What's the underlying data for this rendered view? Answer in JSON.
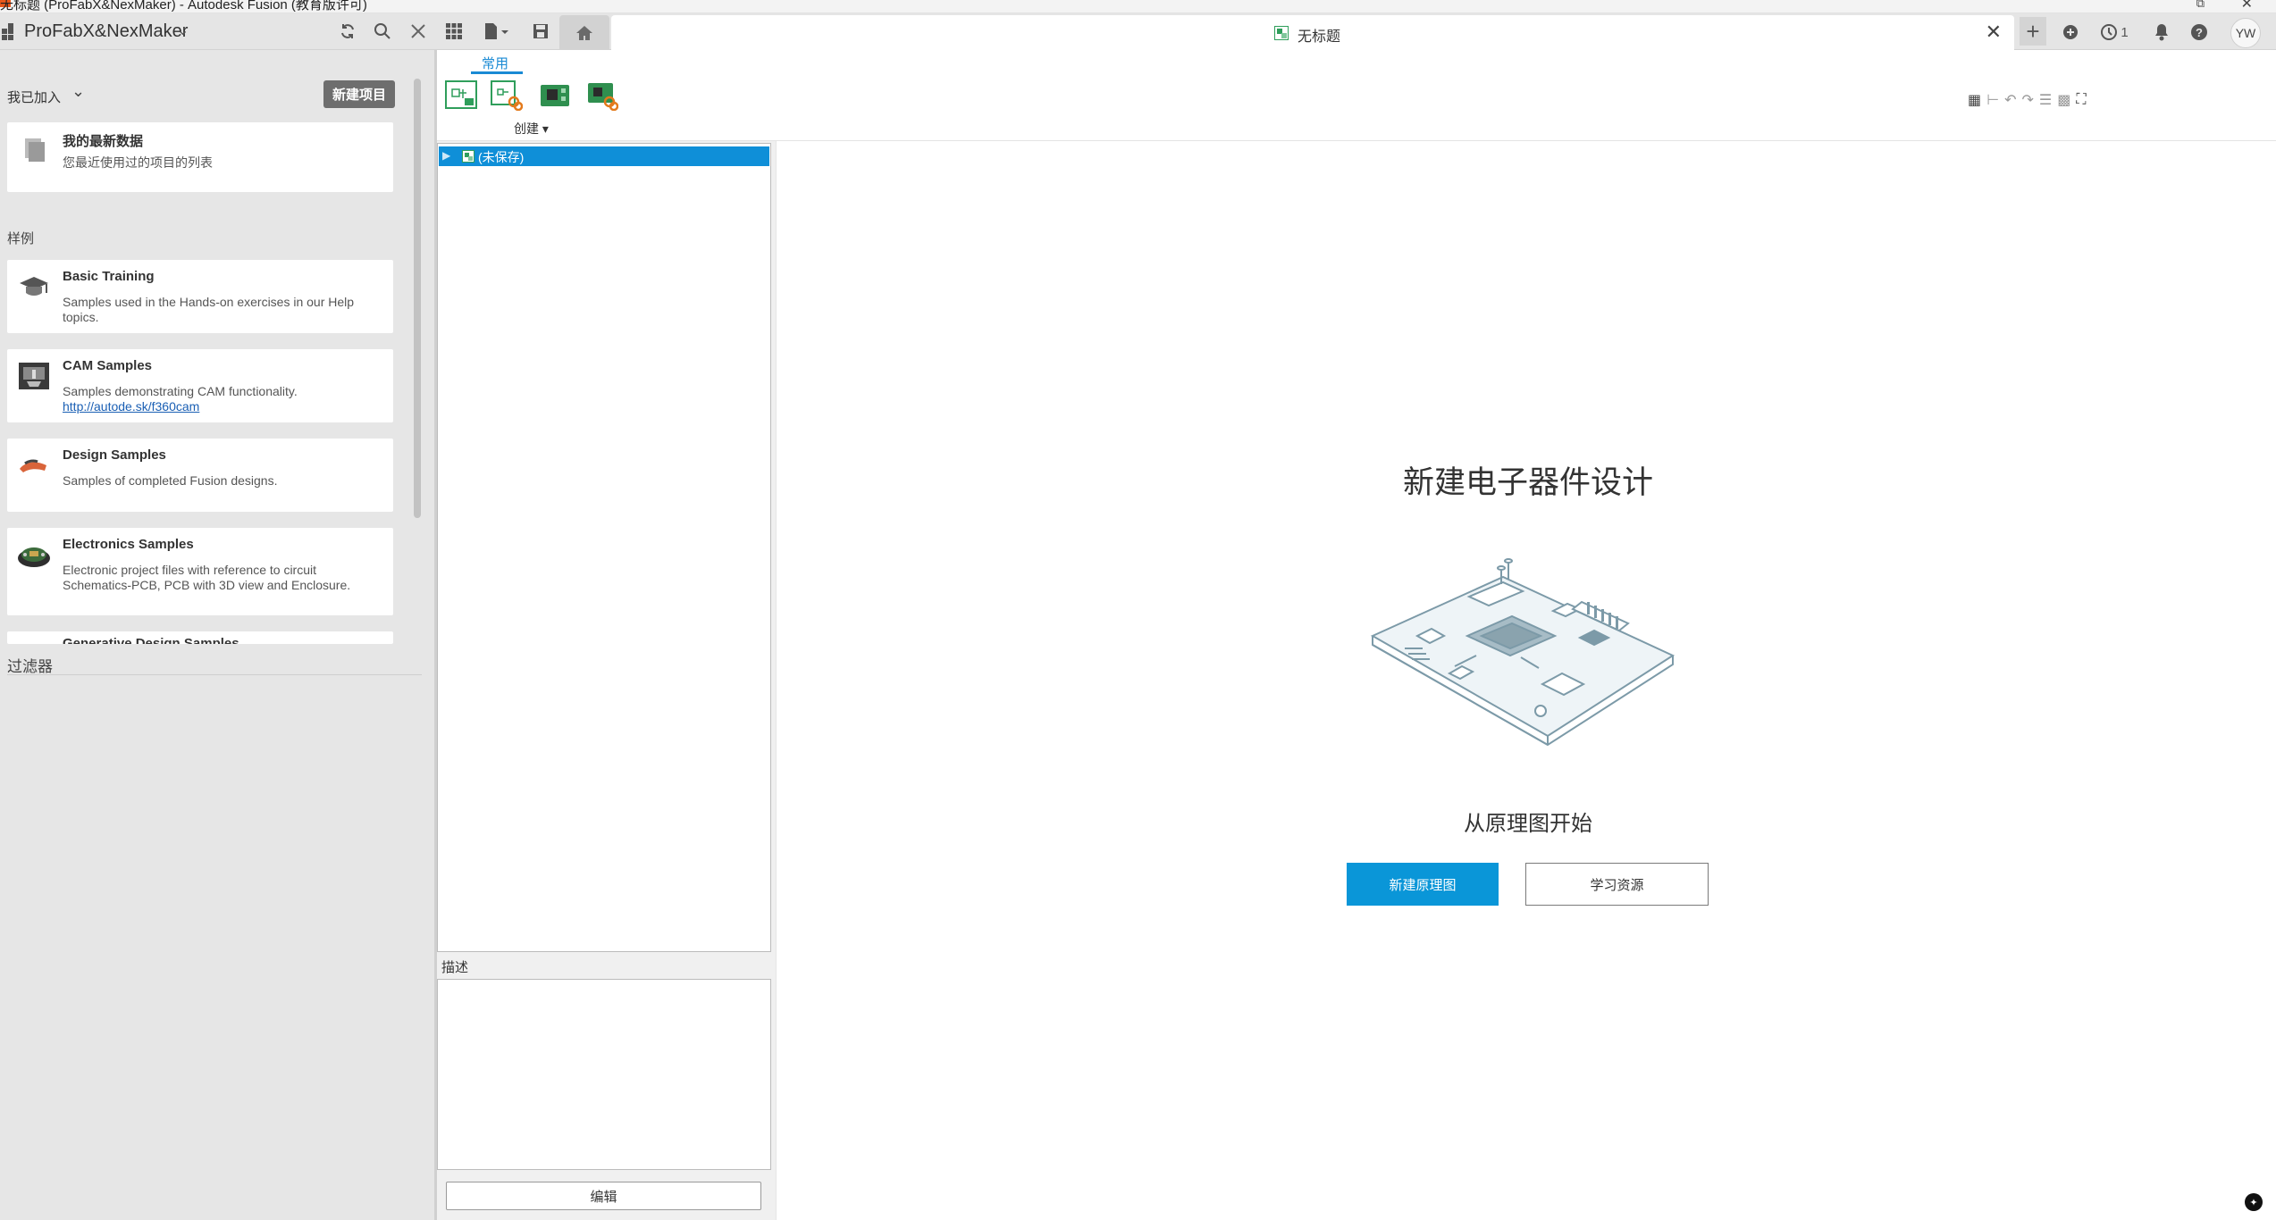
{
  "window": {
    "title": "无标题 (ProFabX&NexMaker) - Autodesk Fusion (教育版许可)",
    "restore_glyph": "⧉",
    "close_glyph": "✕"
  },
  "toolbar": {
    "project_name": "ProFabX&NexMaker",
    "icons": [
      "grid-icon",
      "refresh-icon",
      "search-icon",
      "close-icon",
      "apps-grid-icon",
      "file-icon",
      "save-icon",
      "home-icon"
    ]
  },
  "document_tab": {
    "title": "无标题",
    "close_glyph": "✕"
  },
  "right_toolbar": {
    "add_glyph": "+",
    "job_count": "1",
    "avatar_initials": "YW"
  },
  "data_panel": {
    "joined_label": "我已加入",
    "new_project_label": "新建项目",
    "recent": {
      "title": "我的最新数据",
      "desc": "您最近使用过的项目的列表"
    },
    "samples_label": "样例",
    "samples": [
      {
        "title": "Basic Training",
        "desc": "Samples used in the Hands-on exercises in our Help topics.",
        "link": ""
      },
      {
        "title": "CAM Samples",
        "desc": "Samples demonstrating CAM functionality.",
        "link": "http://autode.sk/f360cam"
      },
      {
        "title": "Design Samples",
        "desc": "Samples of completed Fusion designs.",
        "link": ""
      },
      {
        "title": "Electronics Samples",
        "desc": "Electronic project files with reference to circuit Schematics-PCB, PCB with 3D view and Enclosure.",
        "link": ""
      },
      {
        "title": "Generative Design Samples",
        "desc": "",
        "link": ""
      }
    ],
    "filter_label": "过滤器"
  },
  "ribbon": {
    "active_tab": "常用",
    "create_label": "创建 ▾"
  },
  "browser": {
    "root_label": "(未保存)",
    "desc_label": "描述",
    "edit_button": "编辑"
  },
  "welcome": {
    "title": "新建电子器件设计",
    "subtitle": "从原理图开始",
    "primary_button": "新建原理图",
    "secondary_button": "学习资源"
  },
  "colors": {
    "accent": "#0a96d8",
    "selection": "#0f8fd8",
    "panel_bg": "#e6e6e6",
    "toolbar_bg": "#e5e5e5",
    "button_dark": "#6e6e6e"
  }
}
